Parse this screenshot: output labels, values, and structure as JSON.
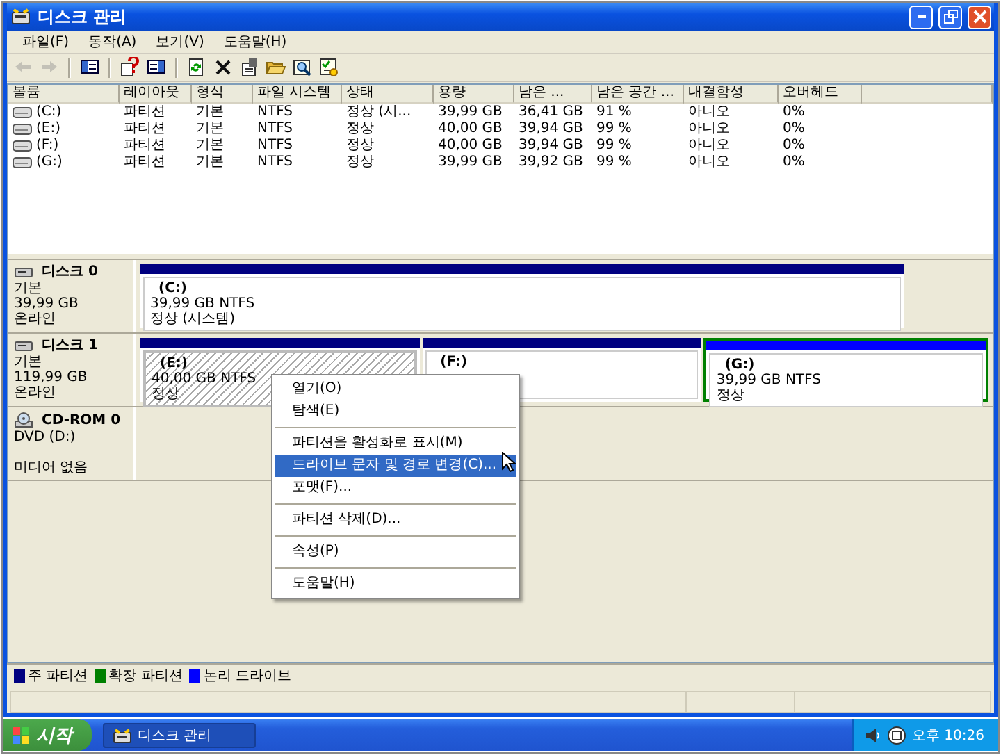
{
  "window": {
    "title": "디스크 관리"
  },
  "menu": [
    {
      "label": "파일(F)"
    },
    {
      "label": "동작(A)"
    },
    {
      "label": "보기(V)"
    },
    {
      "label": "도움말(H)"
    }
  ],
  "toolbar": [
    [
      {
        "kind": "back",
        "disabled": true
      },
      {
        "kind": "forward",
        "disabled": true
      }
    ],
    [
      {
        "kind": "console",
        "disabled": false
      }
    ],
    [
      {
        "kind": "help",
        "disabled": false
      },
      {
        "kind": "pane",
        "disabled": false
      }
    ],
    [
      {
        "kind": "refresh",
        "disabled": false
      },
      {
        "kind": "delete",
        "disabled": false
      },
      {
        "kind": "properties",
        "disabled": false
      },
      {
        "kind": "open",
        "disabled": false
      },
      {
        "kind": "explore",
        "disabled": false
      },
      {
        "kind": "checklist",
        "disabled": false
      }
    ]
  ],
  "volumes": {
    "columns": [
      "볼륨",
      "레이아웃",
      "형식",
      "파일 시스템",
      "상태",
      "용량",
      "남은 ...",
      "남은 공간 ...",
      "내결함성",
      "오버헤드"
    ],
    "rows": [
      [
        "(C:)",
        "파티션",
        "기본",
        "NTFS",
        "정상 (시...",
        "39,99 GB",
        "36,41 GB",
        "91 %",
        "아니오",
        "0%"
      ],
      [
        "(E:)",
        "파티션",
        "기본",
        "NTFS",
        "정상",
        "40,00 GB",
        "39,94 GB",
        "99 %",
        "아니오",
        "0%"
      ],
      [
        "(F:)",
        "파티션",
        "기본",
        "NTFS",
        "정상",
        "40,00 GB",
        "39,94 GB",
        "99 %",
        "아니오",
        "0%"
      ],
      [
        "(G:)",
        "파티션",
        "기본",
        "NTFS",
        "정상",
        "39,99 GB",
        "39,92 GB",
        "99 %",
        "아니오",
        "0%"
      ]
    ]
  },
  "disks": [
    {
      "kind": "disk",
      "name": "디스크 0",
      "type": "기본",
      "size": "39,99 GB",
      "status": "온라인",
      "partitions": [
        {
          "kind": "primary",
          "label": "(C:)",
          "size": "39,99 GB NTFS",
          "status": "정상 (시스템)",
          "selected": false
        }
      ]
    },
    {
      "kind": "disk",
      "name": "디스크 1",
      "type": "기본",
      "size": "119,99 GB",
      "status": "온라인",
      "partitions": [
        {
          "kind": "primary",
          "label": "(E:)",
          "size": "40,00 GB NTFS",
          "status": "정상",
          "selected": true
        },
        {
          "kind": "primary",
          "label": "(F:)",
          "selected": false
        },
        {
          "kind": "logical",
          "label": "(G:)",
          "size": "39,99 GB NTFS",
          "status": "정상",
          "selected": false
        }
      ]
    },
    {
      "kind": "cdrom",
      "name": "CD-ROM 0",
      "type": "DVD (D:)",
      "status": "미디어 없음"
    }
  ],
  "legend": [
    {
      "label": "주 파티션",
      "color": "#000080"
    },
    {
      "label": "확장 파티션",
      "color": "#008000"
    },
    {
      "label": "논리 드라이브",
      "color": "#0000ff"
    }
  ],
  "context_menu": [
    [
      {
        "label": "열기(O)",
        "selected": false
      },
      {
        "label": "탐색(E)",
        "selected": false
      }
    ],
    [
      {
        "label": "파티션을 활성화로 표시(M)",
        "selected": false
      },
      {
        "label": "드라이브 문자 및 경로 변경(C)...",
        "selected": true
      },
      {
        "label": "포맷(F)...",
        "selected": false
      }
    ],
    [
      {
        "label": "파티션 삭제(D)...",
        "selected": false
      }
    ],
    [
      {
        "label": "속성(P)",
        "selected": false
      }
    ],
    [
      {
        "label": "도움말(H)",
        "selected": false
      }
    ]
  ],
  "taskbar": {
    "start": "시작",
    "tasks": [
      {
        "label": "디스크 관리",
        "selected": true
      }
    ],
    "clock": "오후 10:26"
  }
}
